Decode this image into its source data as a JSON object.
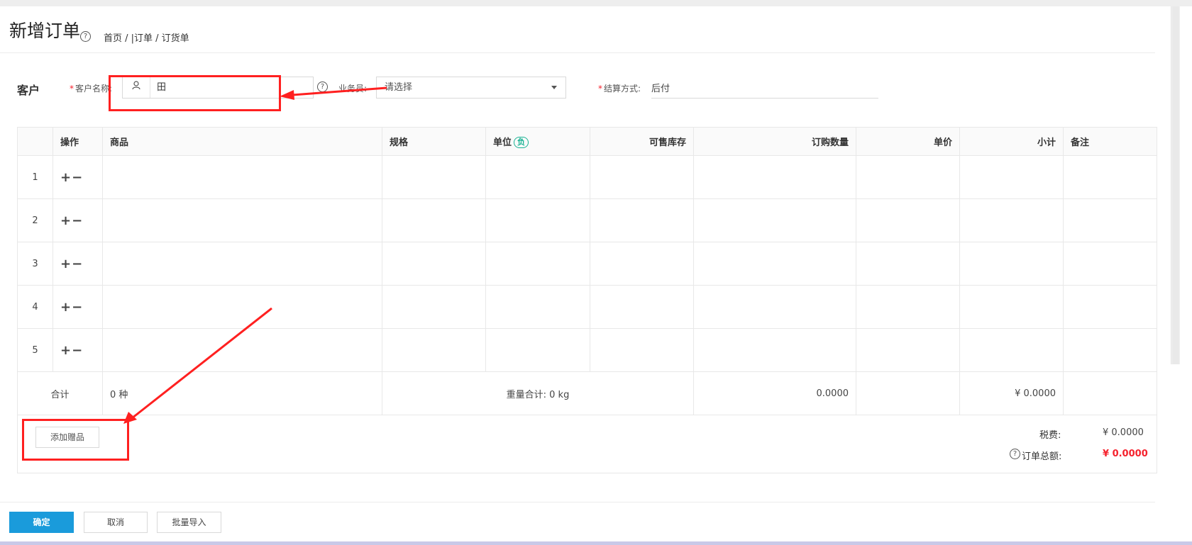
{
  "header": {
    "title": "新增订单",
    "breadcrumb": "首页 / |订单 / 订货单"
  },
  "customer_section": {
    "label": "客户",
    "customer_name_label": "客户名称:",
    "customer_name_value": "田",
    "salesperson_label": "业务员:",
    "salesperson_value": "请选择",
    "settlement_label": "结算方式:",
    "settlement_value": "后付"
  },
  "table": {
    "columns": [
      "操作",
      "商品",
      "规格",
      "单位",
      "可售库存",
      "订购数量",
      "单价",
      "小计",
      "备注"
    ],
    "unit_badge": "负",
    "row_numbers": [
      "1",
      "2",
      "3",
      "4",
      "5"
    ],
    "row_ops": "+−"
  },
  "totals": {
    "label": "合计",
    "item_count": "0 种",
    "weight": "重量合计: 0 kg",
    "quantity": "0.0000",
    "subtotal": "¥ 0.0000"
  },
  "summary": {
    "add_gift_button": "添加赠品",
    "tax_label": "税费:",
    "tax_value": "¥ 0.0000",
    "order_total_label": "订单总额:",
    "order_total_value": "¥ 0.0000"
  },
  "actions": {
    "confirm": "确定",
    "cancel": "取消",
    "batch_import": "批量导入"
  },
  "colors": {
    "primary": "#1a9bdb",
    "required": "#f5222d",
    "annotation": "#ff2020",
    "badge": "#1ab394"
  }
}
